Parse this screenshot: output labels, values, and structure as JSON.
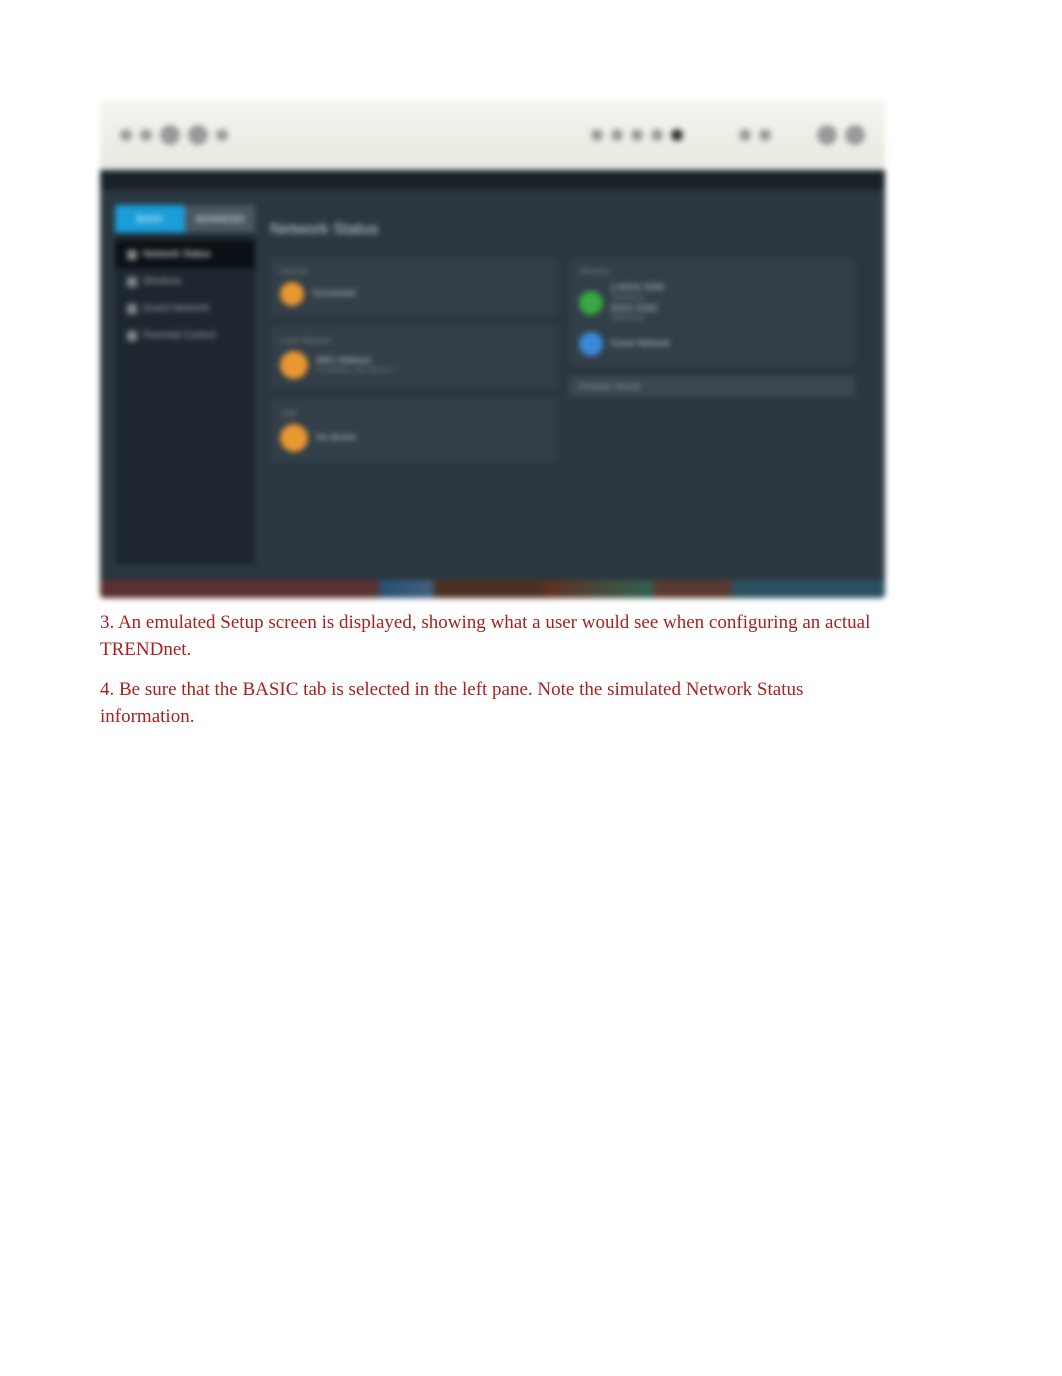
{
  "router": {
    "tabs": {
      "basic": "BASIC",
      "advanced": "ADVANCED"
    },
    "nav": {
      "network_status": "Network Status",
      "wireless": "Wireless",
      "guest": "Guest Network",
      "parental": "Parental Control"
    },
    "title": "Network Status",
    "sections": {
      "internet": {
        "label": "Internet",
        "value": "Connected"
      },
      "lan": {
        "label": "Local Network",
        "line1": "MAC Address",
        "line2": "IP Address: 192.168.10.1"
      },
      "usb": {
        "label": "USB",
        "value": "No device"
      },
      "wifi": {
        "label": "Wireless",
        "band24": "2.4GHz SSID",
        "band5": "5GHz SSID",
        "sub": "TRENDnet",
        "guest": "Guest Network"
      },
      "fw": {
        "label": "Firmware Version",
        "value": ""
      }
    }
  },
  "captions": {
    "c3": "3. An emulated Setup screen is displayed, showing what a user would see when configuring an actual TRENDnet.",
    "c4": "4. Be sure that the BASIC tab is selected in the left pane. Note the simulated Network Status information."
  }
}
